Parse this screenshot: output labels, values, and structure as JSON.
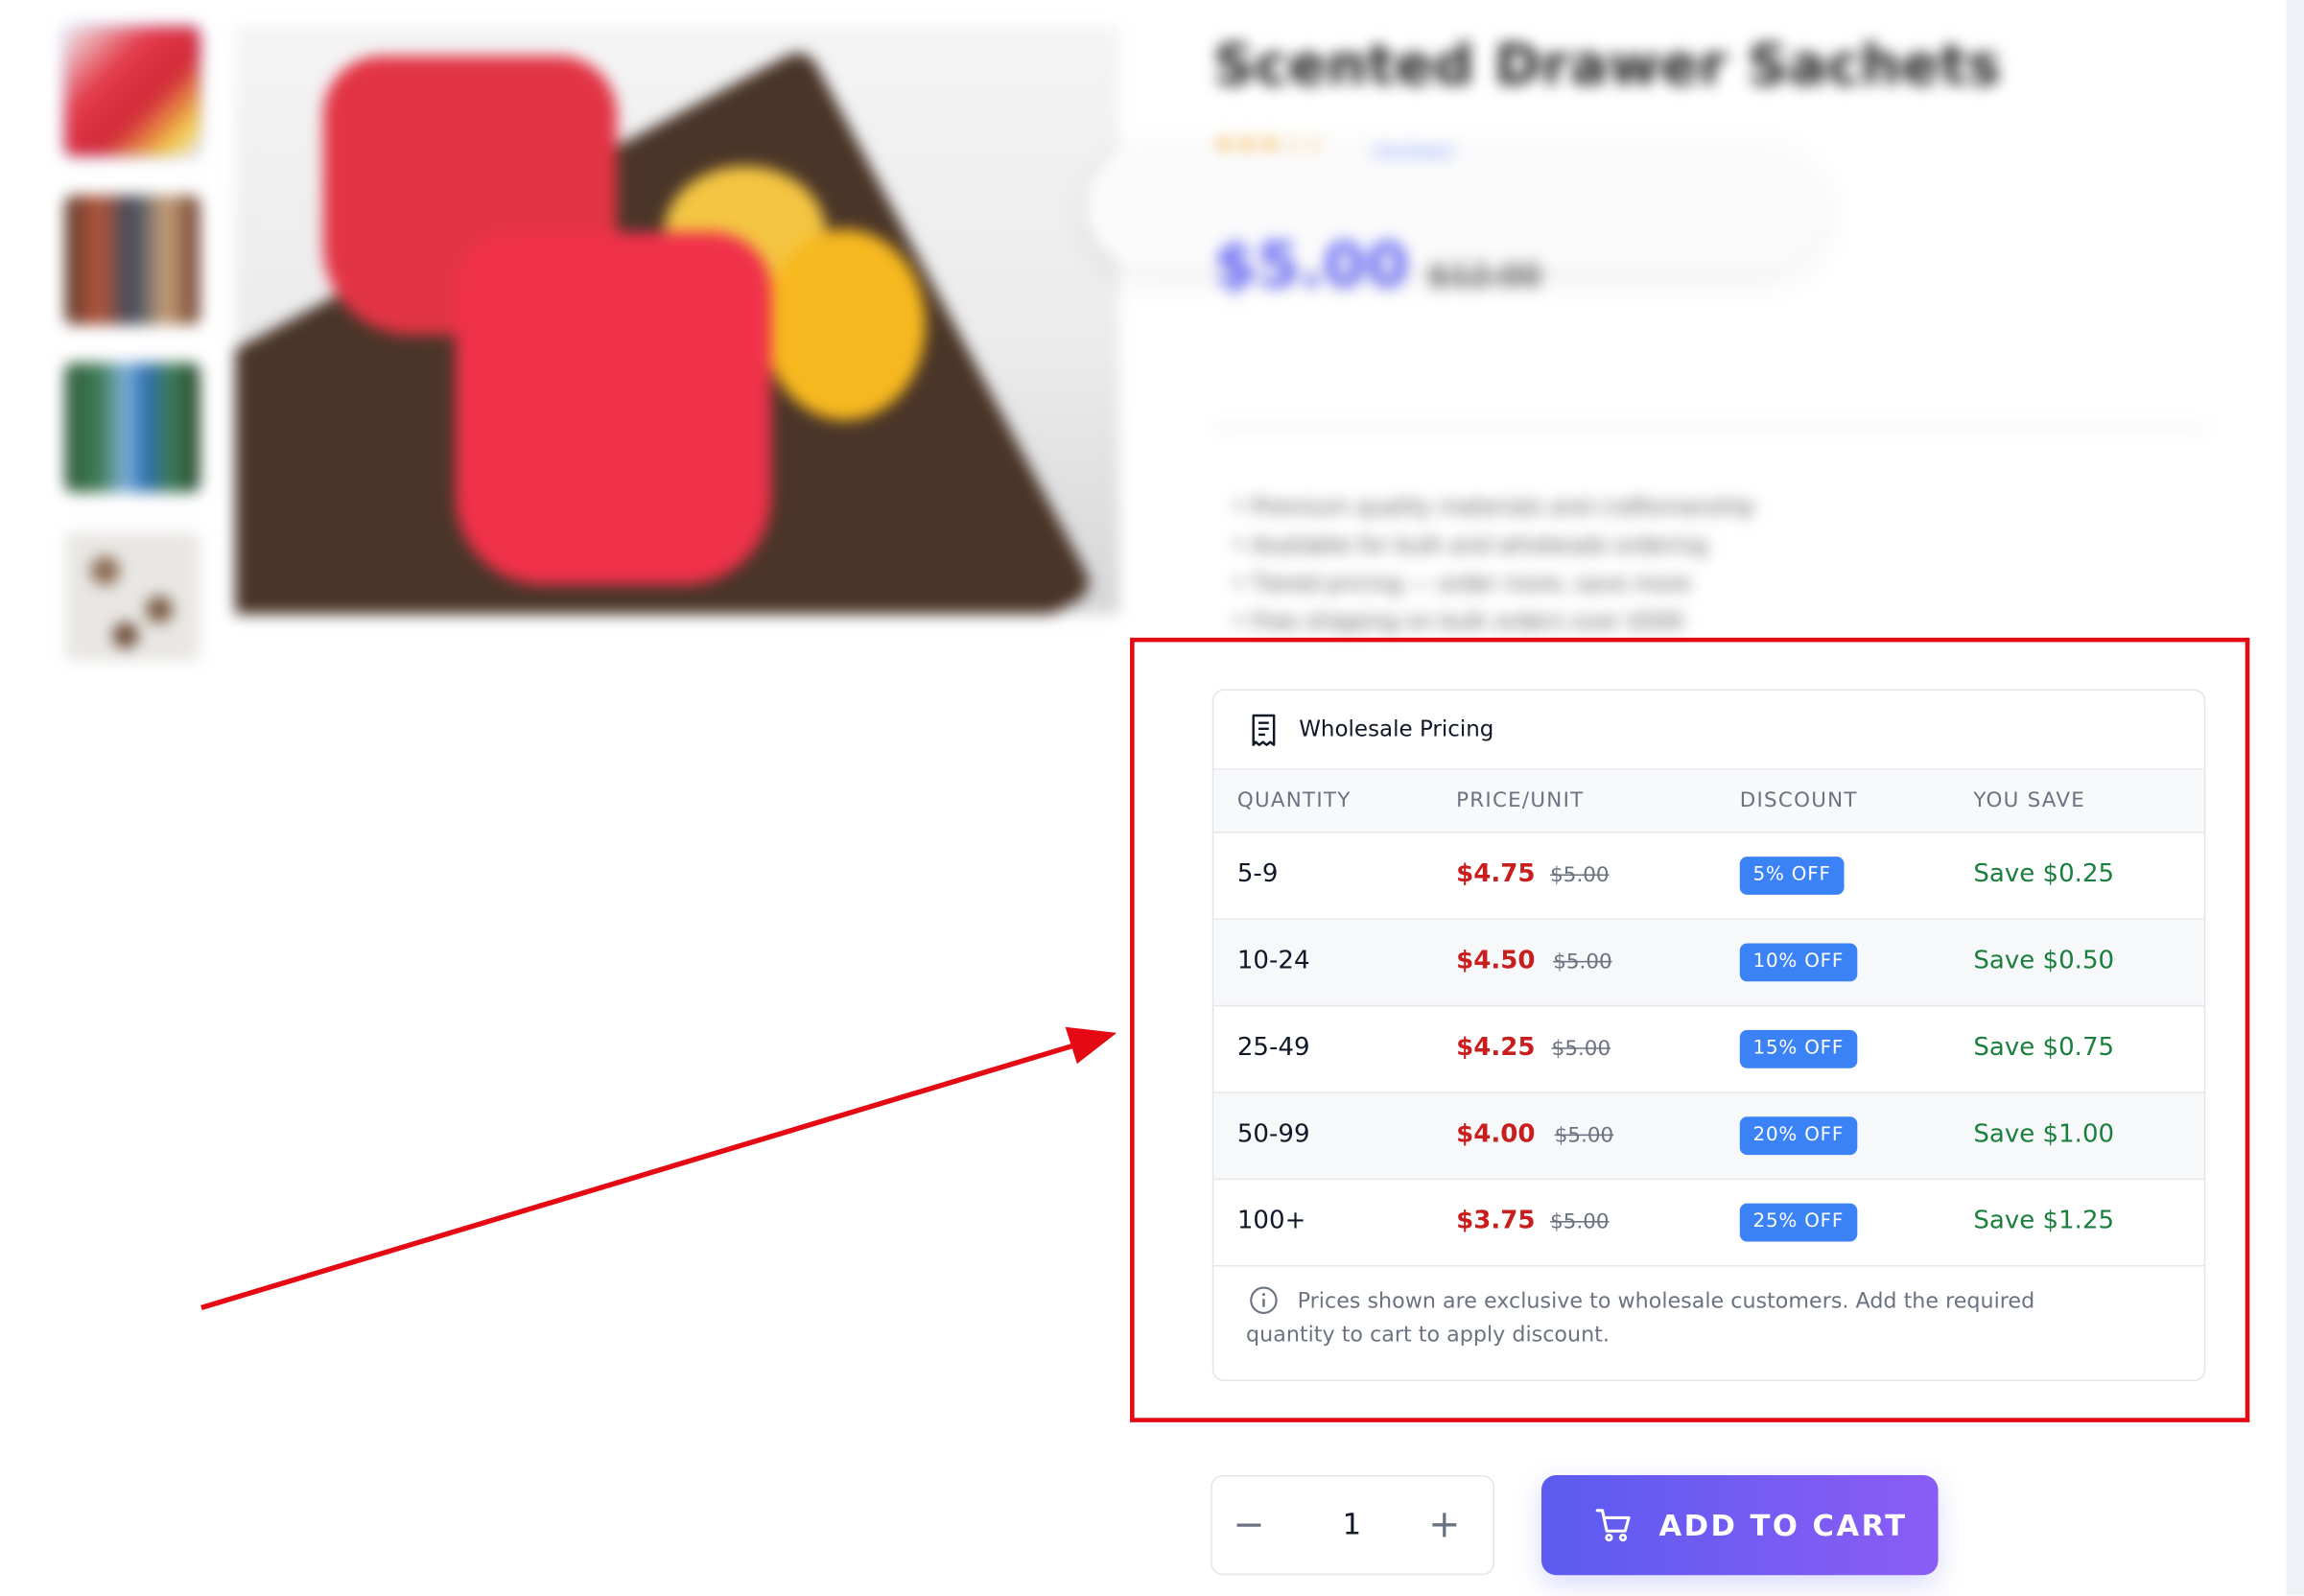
{
  "product": {
    "title": "Scented Drawer Sachets",
    "rating_stars": "★★★☆☆",
    "reviews": "(reviews)",
    "price": "$5.00",
    "old_price": "$12.00",
    "features": [
      "• Premium quality materials and craftsmanship",
      "• Available for bulk and wholesale ordering",
      "• Tiered pricing — order more, save more",
      "• Free shipping on bulk orders over $500"
    ]
  },
  "wholesale": {
    "title": "Wholesale Pricing",
    "icon": "receipt-icon",
    "columns": [
      "QUANTITY",
      "PRICE/UNIT",
      "DISCOUNT",
      "YOU SAVE"
    ],
    "rows": [
      {
        "qty": "5-9",
        "price": "$4.75",
        "was": "$5.00",
        "discount": "5% OFF",
        "save": "Save $0.25"
      },
      {
        "qty": "10-24",
        "price": "$4.50",
        "was": "$5.00",
        "discount": "10% OFF",
        "save": "Save $0.50"
      },
      {
        "qty": "25-49",
        "price": "$4.25",
        "was": "$5.00",
        "discount": "15% OFF",
        "save": "Save $0.75"
      },
      {
        "qty": "50-99",
        "price": "$4.00",
        "was": "$5.00",
        "discount": "20% OFF",
        "save": "Save $1.00"
      },
      {
        "qty": "100+",
        "price": "$3.75",
        "was": "$5.00",
        "discount": "25% OFF",
        "save": "Save $1.25"
      }
    ],
    "note": "Prices shown are exclusive to wholesale customers. Add the required quantity to cart to apply discount."
  },
  "purchase": {
    "quantity": "1",
    "minus": "−",
    "plus": "+",
    "add_to_cart": "ADD TO CART"
  },
  "colors": {
    "accent": "#6366f1",
    "annotation": "#e50914",
    "price_red": "#c81e1e",
    "save_green": "#1a7f3c",
    "badge_blue": "#3b82f6"
  }
}
